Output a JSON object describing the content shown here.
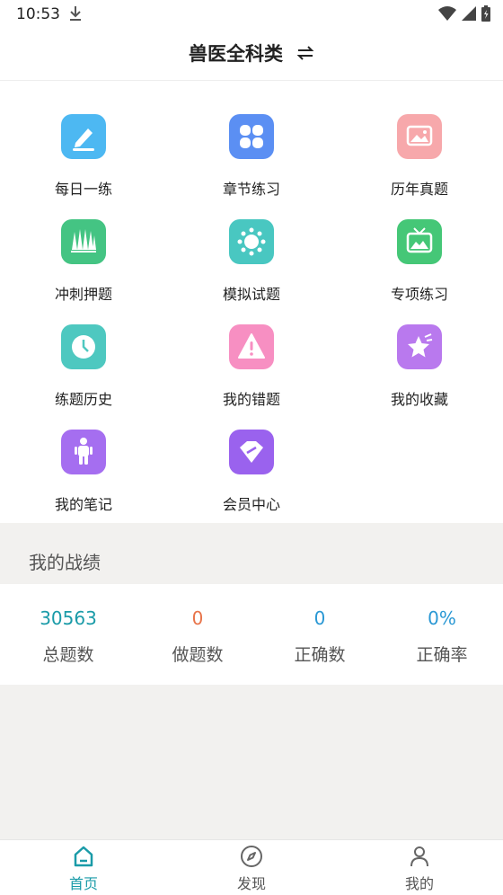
{
  "status_bar": {
    "time": "10:53"
  },
  "header": {
    "title": "兽医全科类"
  },
  "colors": {
    "accent": "#1a9ba8",
    "orange": "#e8744a",
    "blue": "#2a98d4"
  },
  "menu": [
    {
      "label": "每日一练",
      "icon": "pencil-icon",
      "color": "#4db8f2"
    },
    {
      "label": "章节练习",
      "icon": "grid-icon",
      "color": "#5b8ff3"
    },
    {
      "label": "历年真题",
      "icon": "image-icon",
      "color": "#f7a8ab"
    },
    {
      "label": "冲刺押题",
      "icon": "forest-icon",
      "color": "#44c483"
    },
    {
      "label": "模拟试题",
      "icon": "sun-icon",
      "color": "#49c7c1"
    },
    {
      "label": "专项练习",
      "icon": "tv-icon",
      "color": "#45c777"
    },
    {
      "label": "练题历史",
      "icon": "clock-icon",
      "color": "#4ec8c0"
    },
    {
      "label": "我的错题",
      "icon": "warning-icon",
      "color": "#f78fc2"
    },
    {
      "label": "我的收藏",
      "icon": "star-icon",
      "color": "#b979ee"
    },
    {
      "label": "我的笔记",
      "icon": "person-icon",
      "color": "#a56ef0"
    },
    {
      "label": "会员中心",
      "icon": "diamond-icon",
      "color": "#9a62ee"
    }
  ],
  "stats": {
    "title": "我的战绩",
    "items": [
      {
        "value": "30563",
        "label": "总题数"
      },
      {
        "value": "0",
        "label": "做题数"
      },
      {
        "value": "0",
        "label": "正确数"
      },
      {
        "value": "0%",
        "label": "正确率"
      }
    ]
  },
  "nav": [
    {
      "label": "首页",
      "icon": "home-icon"
    },
    {
      "label": "发现",
      "icon": "compass-icon"
    },
    {
      "label": "我的",
      "icon": "user-icon"
    }
  ]
}
